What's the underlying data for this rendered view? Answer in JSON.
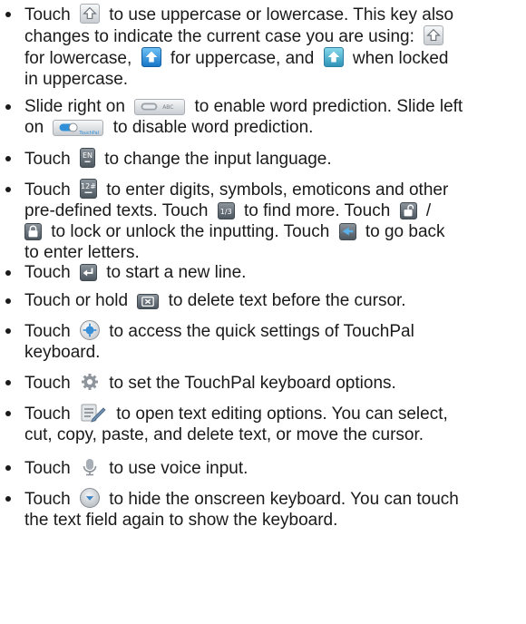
{
  "colors": {
    "text": "#1a1a1a",
    "key_dark": "#4d5760",
    "key_blue": "#1776c8",
    "key_light": "#d6dadd"
  },
  "icons": {
    "case_key": "shift-arrow-icon",
    "case_lower": "shift-lowercase-icon",
    "case_upper": "shift-uppercase-icon",
    "case_locked": "shift-locked-icon",
    "prediction_on": "prediction-toggle-on-icon",
    "prediction_off": "prediction-toggle-off-icon",
    "language": "language-key-icon",
    "symbols": "symbols-key-icon",
    "more_page": "page-indicator-icon",
    "unlocked": "unlock-icon",
    "locked": "lock-icon",
    "back": "back-arrow-icon",
    "enter": "enter-key-icon",
    "delete": "delete-key-icon",
    "quick_settings": "quick-settings-icon",
    "options": "gear-icon",
    "edit": "text-edit-icon",
    "voice": "microphone-icon",
    "hide": "hide-keyboard-icon"
  },
  "key_text": {
    "language": "EN",
    "symbols": "12#",
    "more_page": "1/3",
    "prediction_on": "ABC",
    "prediction_off": "TouchPal"
  },
  "items": [
    {
      "lines": [
        [
          "Touch",
          "to use uppercase or lowercase. This key also"
        ],
        [
          "changes to indicate the current case you are using:"
        ],
        [
          "for lowercase,",
          "for uppercase, and",
          "when locked"
        ],
        [
          "in uppercase."
        ]
      ]
    },
    {
      "lines": [
        [
          "Slide right on",
          "to enable word prediction. Slide left"
        ],
        [
          "on",
          "to disable word prediction."
        ]
      ]
    },
    {
      "lines": [
        [
          "Touch",
          "to change the input language."
        ]
      ]
    },
    {
      "lines": [
        [
          "Touch",
          "to enter digits, symbols, emoticons and other"
        ],
        [
          "pre-defined texts. Touch",
          "to find more. Touch",
          "/"
        ],
        [
          "to lock or unlock the inputting. Touch",
          "to go back"
        ],
        [
          "to enter letters."
        ]
      ]
    },
    {
      "lines": [
        [
          "Touch",
          "to start a new line."
        ]
      ]
    },
    {
      "lines": [
        [
          "Touch or hold",
          "to delete text before the cursor."
        ]
      ]
    },
    {
      "lines": [
        [
          "Touch",
          "to access the quick settings of TouchPal"
        ],
        [
          "keyboard."
        ]
      ]
    },
    {
      "lines": [
        [
          "Touch",
          "to set the TouchPal keyboard options."
        ]
      ]
    },
    {
      "lines": [
        [
          "Touch",
          "to open text editing options. You can select,"
        ],
        [
          "cut, copy, paste, and delete text, or move the cursor."
        ]
      ]
    },
    {
      "lines": [
        [
          "Touch",
          "to use voice input."
        ]
      ]
    },
    {
      "lines": [
        [
          "Touch",
          "to hide the onscreen keyboard. You can touch"
        ],
        [
          "the text field again to show the keyboard."
        ]
      ]
    }
  ]
}
